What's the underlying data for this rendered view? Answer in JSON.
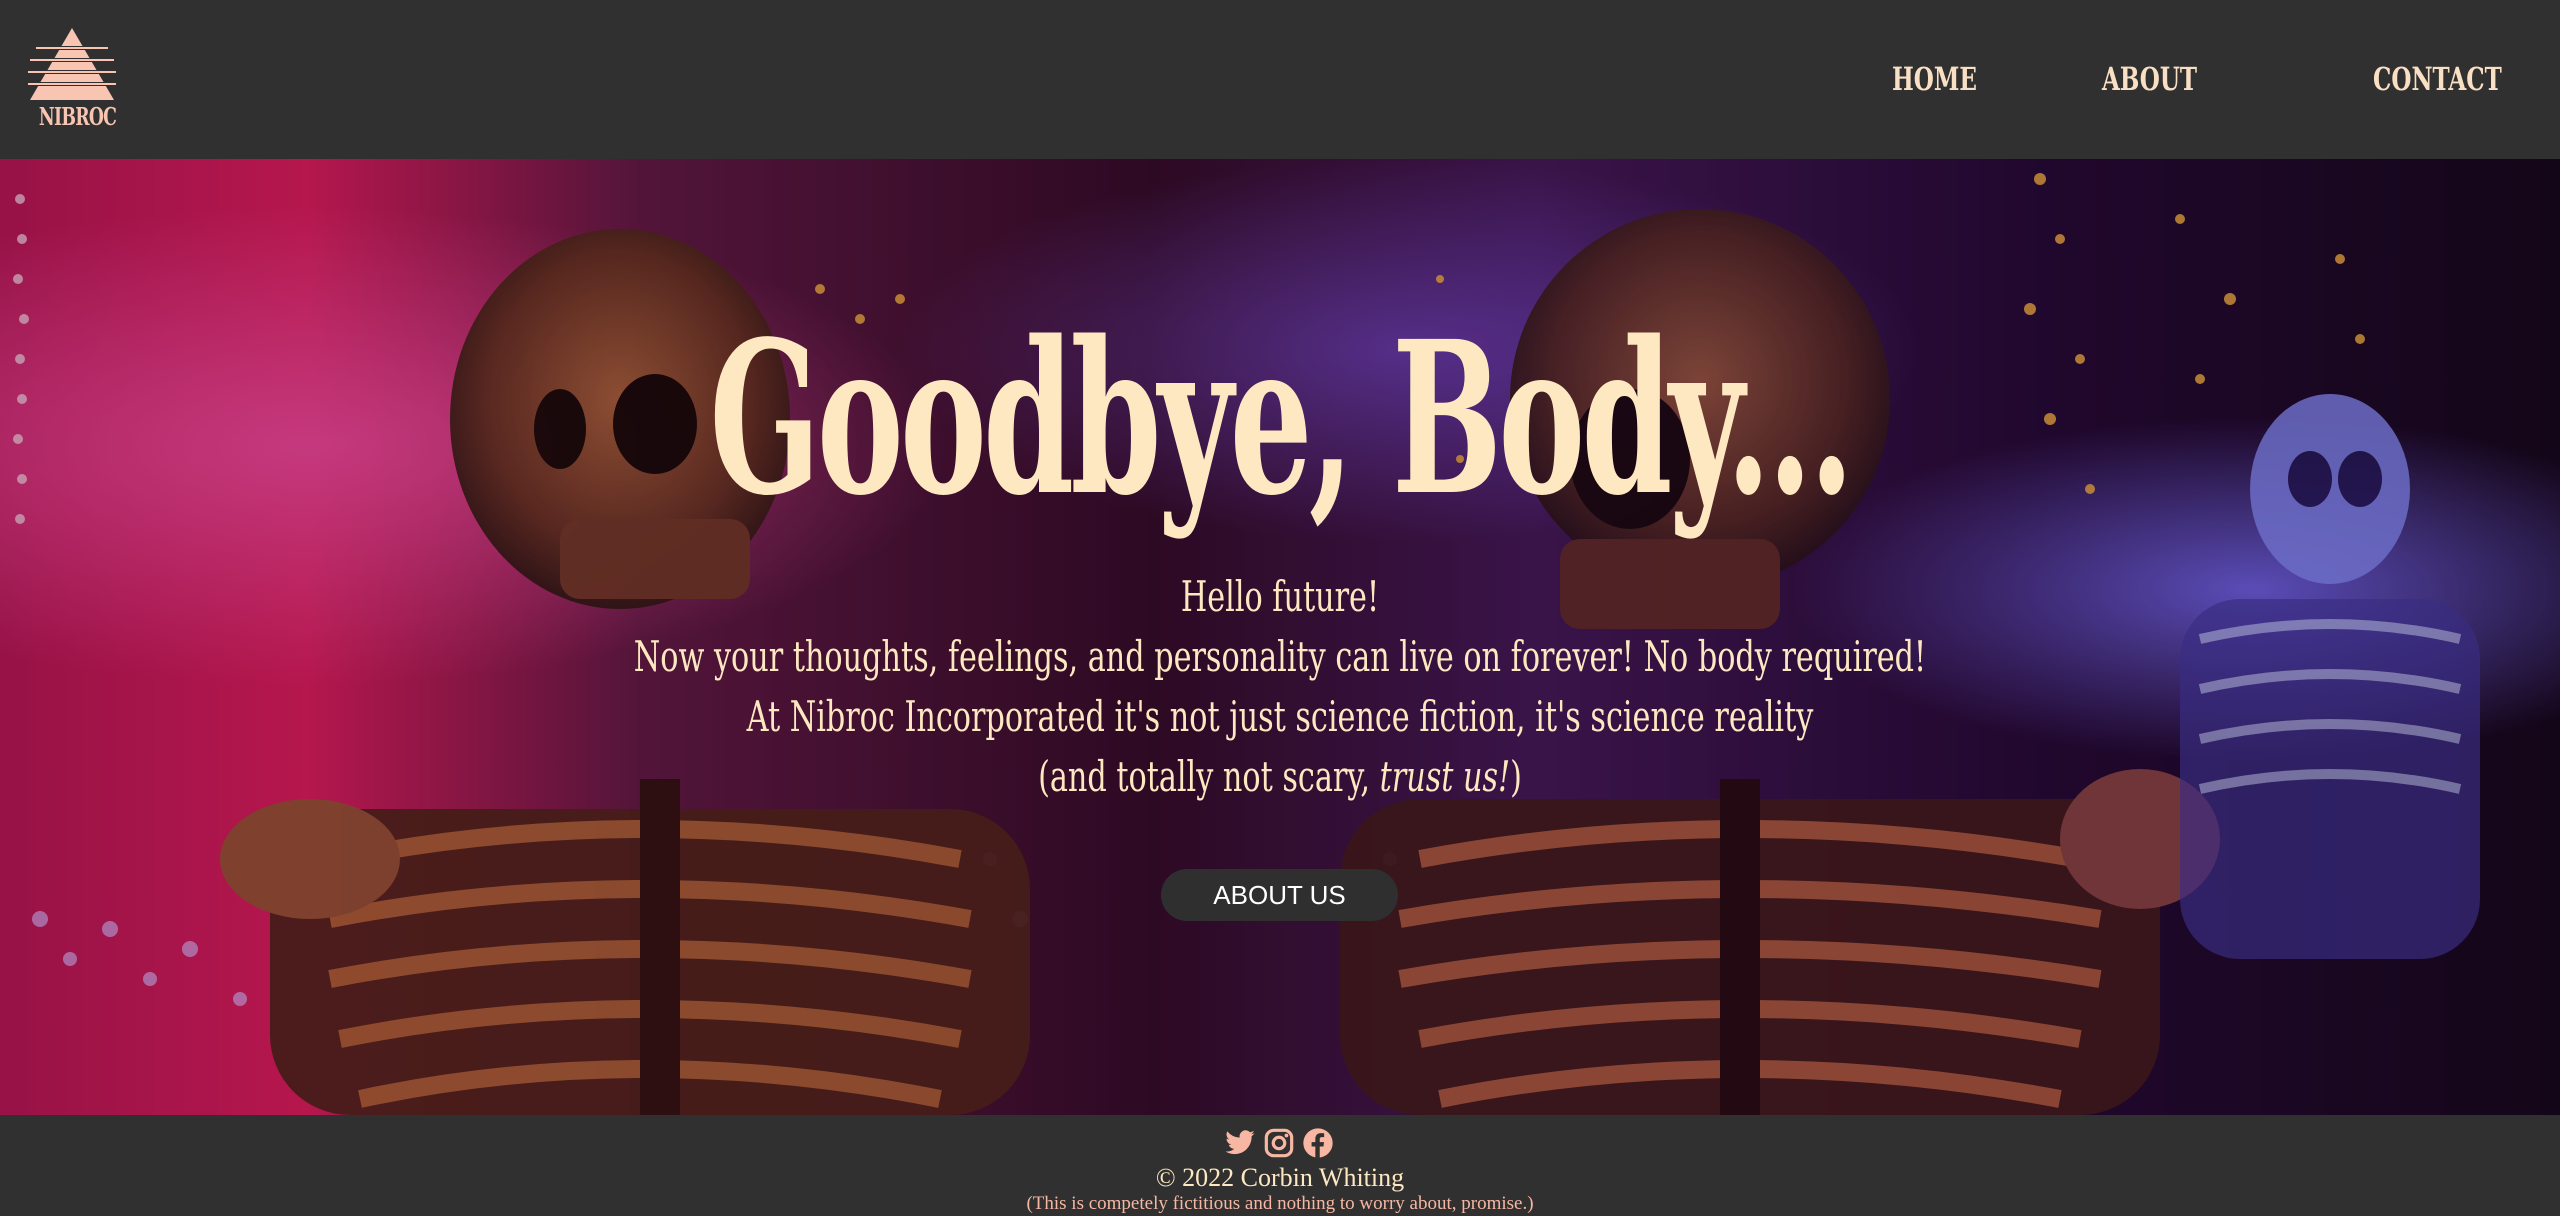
{
  "brand": {
    "logo_text": "NIBROC",
    "logo_color": "#f7c5b2"
  },
  "nav": {
    "items": [
      {
        "label": "HOME"
      },
      {
        "label": "ABOUT"
      },
      {
        "label": "CONTACT"
      }
    ],
    "color": "#f9e0c4"
  },
  "hero": {
    "title": "Goodbye, Body...",
    "lines": [
      "Hello future!",
      "Now your thoughts, feelings, and personality can live on forever! No body required!",
      "At Nibroc Incorporated it's not just science fiction, it's science reality"
    ],
    "last_line_prefix": "(and totally not scary, ",
    "last_line_italic": "trust us!",
    "last_line_suffix": ")",
    "button_label": "ABOUT US",
    "background_icon": "skeletons-halloween-lights-photo",
    "text_color": "#fde8c2"
  },
  "footer": {
    "social_icons": [
      "twitter-icon",
      "instagram-icon",
      "facebook-icon"
    ],
    "copyright": "© 2022 Corbin Whiting",
    "disclaimer": "(This is competely fictitious and nothing to worry about, promise.)",
    "icon_color": "#f7b7a3"
  }
}
